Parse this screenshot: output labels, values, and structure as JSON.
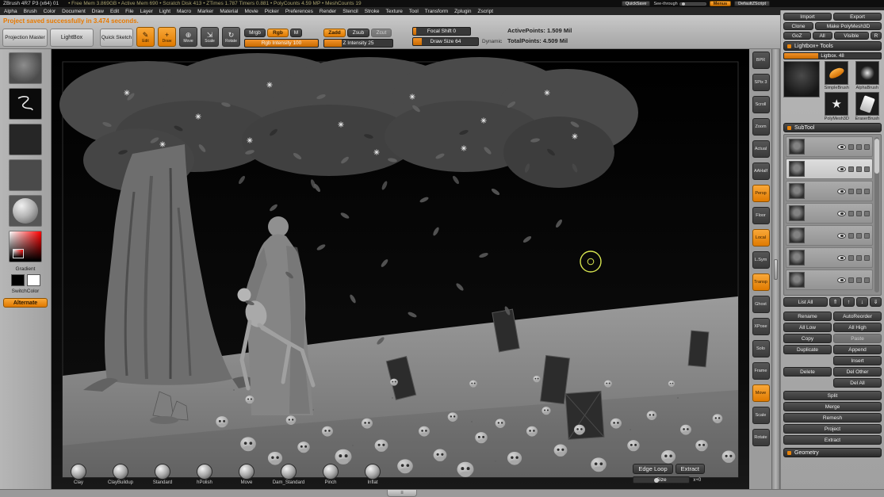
{
  "titlebar": {
    "title": "ZBrush 4R7 P3 (x64)  01",
    "stats": "• Free Mem 3.869GB • Active Mem 690 • Scratch Disk 413 • ZTimes 1.787 Timers 0.881 • PolyCounts 4.59 MP • MeshCounts 19",
    "quicksave": "QuickSave",
    "see_through": "See-through",
    "menus": "Menus",
    "default_zscript": "DefaultZScript"
  },
  "menubar": {
    "items": [
      "Alpha",
      "Brush",
      "Color",
      "Document",
      "Draw",
      "Edit",
      "File",
      "Layer",
      "Light",
      "Macro",
      "Marker",
      "Material",
      "Movie",
      "Picker",
      "Preferences",
      "Render",
      "Stencil",
      "Stroke",
      "Texture",
      "Tool",
      "Transform",
      "Zplugin",
      "Zscript"
    ]
  },
  "notification": "Project saved successfully in 3.474 seconds.",
  "shelf": {
    "projection_master": "Projection Master",
    "lightbox": "LightBox",
    "quick_sketch": "Quick Sketch",
    "modes": [
      {
        "label": "Edit",
        "g": "✎",
        "cls": "on"
      },
      {
        "label": "Draw",
        "g": "+",
        "cls": "on"
      },
      {
        "label": "Move",
        "g": "⊕",
        "cls": ""
      },
      {
        "label": "Scale",
        "g": "⇲",
        "cls": ""
      },
      {
        "label": "Rotate",
        "g": "↻",
        "cls": ""
      }
    ],
    "mrgb": "Mrgb",
    "rgb": "Rgb",
    "m": "M",
    "rgb_intensity": "Rgb Intensity 100",
    "zadd": "Zadd",
    "zsub": "Zsub",
    "zcut": "Zcut",
    "z_intensity": "Z Intensity 25",
    "focal_shift": "Focal Shift 0",
    "draw_size": "Draw Size 64",
    "dynamic": "Dynamic",
    "active_points": "ActivePoints: 1.509 Mil",
    "total_points": "TotalPoints: 4.509 Mil"
  },
  "left_tray": {
    "gradient": "Gradient",
    "switch_color": "SwitchColor",
    "alternate": "Alternate"
  },
  "right_shelf": [
    {
      "label": "BPR",
      "cls": ""
    },
    {
      "label": "SPix 3",
      "cls": ""
    },
    {
      "label": "Scroll",
      "cls": ""
    },
    {
      "label": "Zoom",
      "cls": ""
    },
    {
      "label": "Actual",
      "cls": ""
    },
    {
      "label": "AAHalf",
      "cls": ""
    },
    {
      "label": "Persp",
      "cls": "active"
    },
    {
      "label": "Floor",
      "cls": ""
    },
    {
      "label": "Local",
      "cls": "active"
    },
    {
      "label": "L.Sym",
      "cls": ""
    },
    {
      "label": "Transp",
      "cls": "active"
    },
    {
      "label": "Ghost",
      "cls": ""
    },
    {
      "label": "XPose",
      "cls": ""
    },
    {
      "label": "Solo",
      "cls": ""
    },
    {
      "label": "Frame",
      "cls": ""
    },
    {
      "label": "Move",
      "cls": "active"
    },
    {
      "label": "Scale",
      "cls": ""
    },
    {
      "label": "Rotate",
      "cls": ""
    }
  ],
  "canvas": {
    "brushes": [
      "Clay",
      "ClayBuildup",
      "Standard",
      "hPolish",
      "Move",
      "Dam_Standard",
      "Pinch",
      "Inflat"
    ],
    "edge_loop": "Edge Loop",
    "extract": "Extract",
    "size_label": "Size",
    "size_value": "x+0"
  },
  "tool_panel": {
    "import": "Import",
    "export": "Export",
    "clone": "Clone",
    "make_polymesh": "Make PolyMesh3D",
    "goz": "GoZ",
    "all": "All",
    "visible": "Visible",
    "r": "R",
    "lightbox_tools": "Lightbox+ Tools",
    "lightbox_slider": "Ligtbox. 48",
    "thumbs": [
      {
        "label": "SimpleBrush",
        "cls": "simple"
      },
      {
        "label": "AlphaBrush",
        "cls": "alpha"
      },
      {
        "label": "PolyMesh3D",
        "cls": "poly"
      },
      {
        "label": "EraserBrush",
        "cls": "eraser"
      }
    ],
    "subtool_header": "SubTool",
    "subtools": [
      {
        "cls": ""
      },
      {
        "cls": "selected"
      },
      {
        "cls": ""
      },
      {
        "cls": ""
      },
      {
        "cls": ""
      },
      {
        "cls": ""
      },
      {
        "cls": ""
      }
    ],
    "list_all": "List All",
    "arrows": [
      {
        "g": "⇑"
      },
      {
        "g": "↑"
      },
      {
        "g": "↓"
      },
      {
        "g": "⇓"
      }
    ],
    "grid": [
      {
        "t": "Rename"
      },
      {
        "t": "AutoReorder"
      },
      {
        "t": "All Low"
      },
      {
        "t": "All High"
      },
      {
        "t": "Copy"
      },
      {
        "t": "Paste",
        "cls": "disabled dis"
      },
      {
        "t": "Duplicate"
      },
      {
        "t": "Append"
      },
      {
        "t": "",
        "cls": "ghost"
      },
      {
        "t": "Insert"
      },
      {
        "t": "Delete"
      },
      {
        "t": "Del Other"
      },
      {
        "t": "",
        "cls": "ghost"
      },
      {
        "t": "Del All"
      }
    ],
    "wide": [
      "Split",
      "Merge",
      "Remesh",
      "Project",
      "Extract"
    ],
    "geometry": "Geometry"
  },
  "footer": {
    "tray_tab": "≡"
  }
}
